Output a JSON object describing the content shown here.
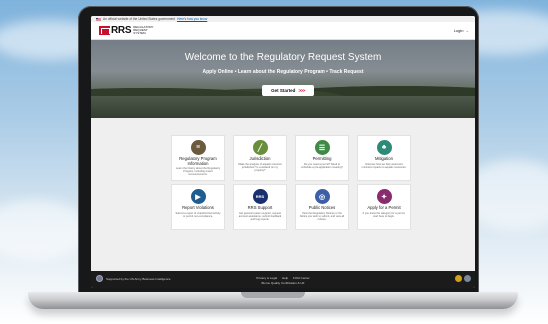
{
  "gov_banner": {
    "text": "An official website of the United States government",
    "link": "Here's how you know"
  },
  "header": {
    "logo_text": "RRS",
    "logo_subtitle_1": "REGULATORY",
    "logo_subtitle_2": "REQUEST",
    "logo_subtitle_3": "SYSTEM",
    "login_label": "Login"
  },
  "hero": {
    "title": "Welcome to the Regulatory Request System",
    "subtitle": "Apply Online • Learn about the Regulatory Program • Track Request",
    "cta_label": "Get Started",
    "cta_chevrons": ">>>"
  },
  "cards": [
    {
      "title": "Regulatory Program Information",
      "desc": "Learn the history about the Regulatory Program, including recent announcements.",
      "icon": "books-icon",
      "color": "#6b5a3e",
      "glyph": "≡"
    },
    {
      "title": "Jurisdiction",
      "desc": "Make the analysis of aquatic resource jurisdiction? Is a wetland on my property?",
      "icon": "road-icon",
      "color": "#6a8f3a",
      "glyph": "╱"
    },
    {
      "title": "Permitting",
      "desc": "Do you need a permit? Need to schedule a pre-application meeting?",
      "icon": "document-icon",
      "color": "#3f8a45",
      "glyph": "☰"
    },
    {
      "title": "Mitigation",
      "desc": "Discover how we help avoid and minimize impacts to aquatic resources.",
      "icon": "tree-icon",
      "color": "#2c8a77",
      "glyph": "♣"
    },
    {
      "title": "Report Violations",
      "desc": "Submit a report of unauthorized activity or permit non-compliance.",
      "icon": "megaphone-icon",
      "color": "#1f5c8f",
      "glyph": "▶"
    },
    {
      "title": "RRS Support",
      "desc": "Get general system support, request account assistance, submit feedback and bug reports.",
      "icon": "rrs-icon",
      "color": "#1a2f6e",
      "glyph": "RRS"
    },
    {
      "title": "Public Notices",
      "desc": "View the Regulatory Notices or the Notice you wish to submit, and view all notices.",
      "icon": "globe-cursor-icon",
      "color": "#3d5fa8",
      "glyph": "◎"
    },
    {
      "title": "Apply for a Permit",
      "desc": "If you know the category for a permit, start here to begin.",
      "icon": "permit-icon",
      "color": "#8a2a6f",
      "glyph": "✦"
    }
  ],
  "footer": {
    "supported_by": "Supported by the US Army Business Intelligence",
    "links": [
      "Privacy & Legal",
      "Help",
      "FOIA Center"
    ],
    "certification": "Biome Quality Certification & HF"
  },
  "colors": {
    "brand_red": "#c8102e",
    "footer_bg": "#1b1b1b"
  }
}
